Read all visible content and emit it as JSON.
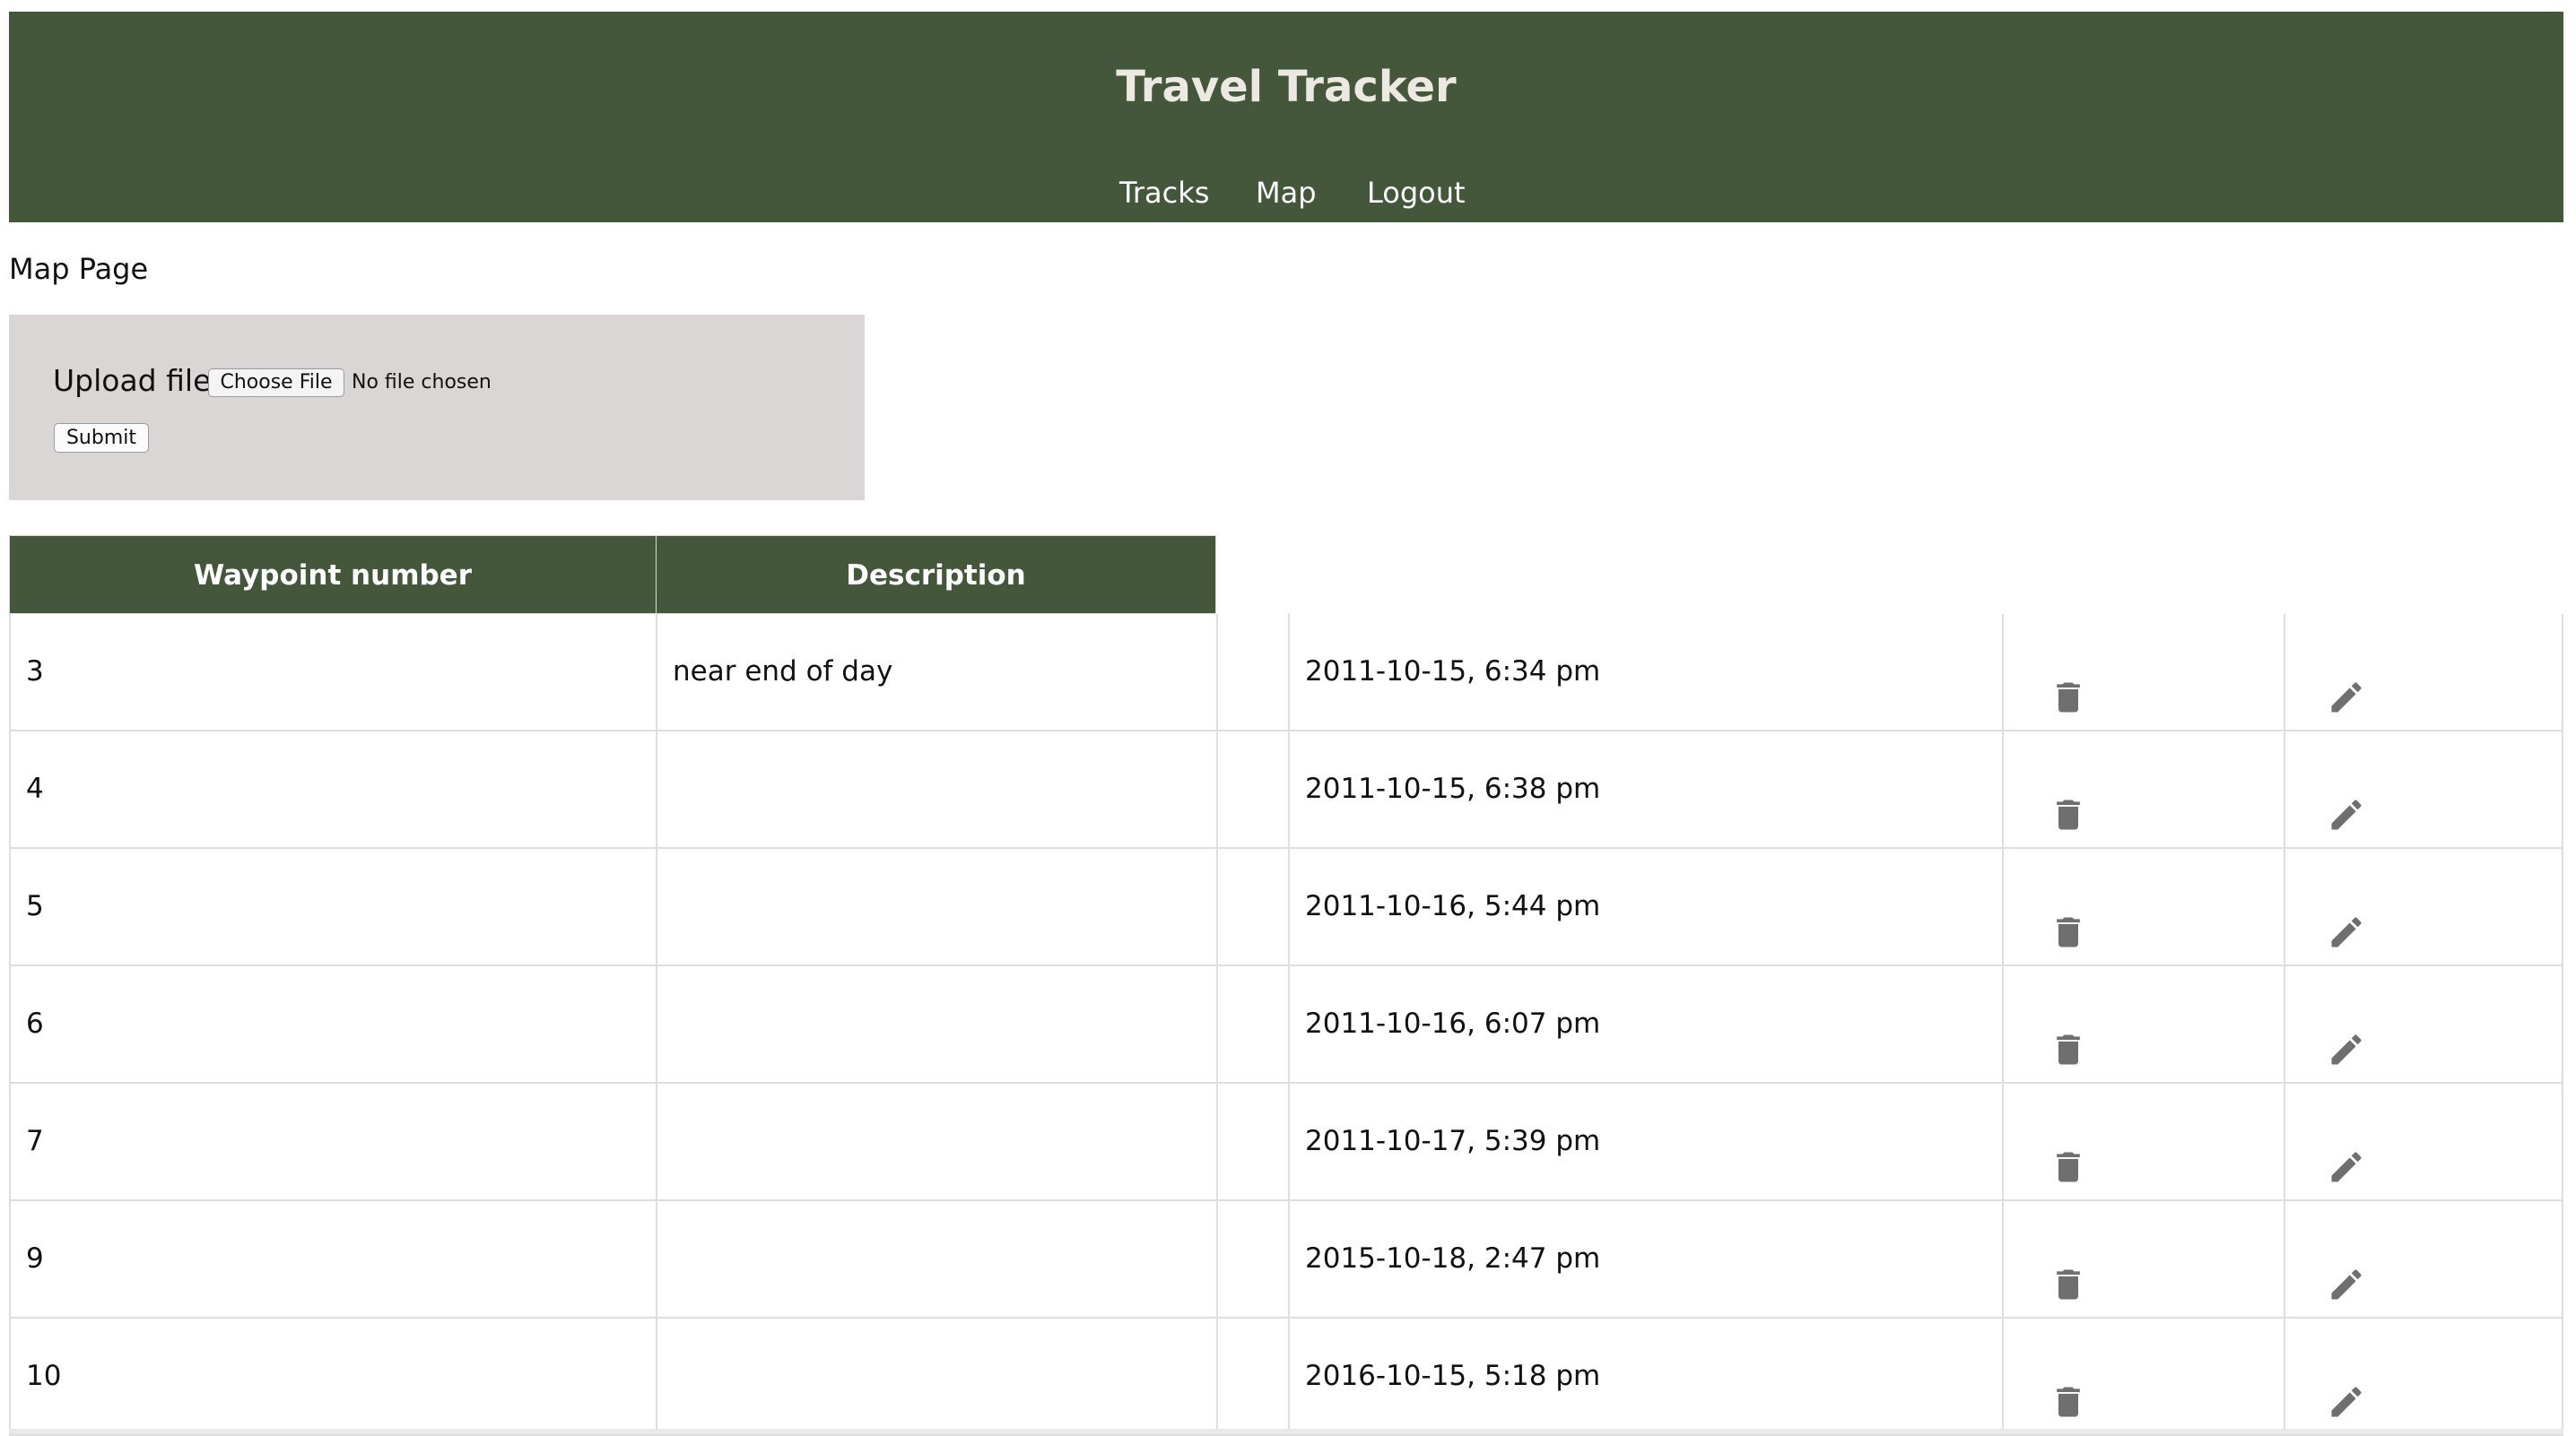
{
  "header": {
    "title": "Travel Tracker",
    "nav": [
      "Tracks",
      "Map",
      "Logout"
    ],
    "background_color": "#44573a"
  },
  "page": {
    "label": "Map Page"
  },
  "upload": {
    "label": "Upload file:",
    "choose_button": "Choose File",
    "file_status": "No file chosen",
    "submit_button": "Submit"
  },
  "table": {
    "headers": [
      "Waypoint number",
      "Description"
    ],
    "rows": [
      {
        "number": "3",
        "description": "near end of day",
        "time": "2011-10-15, 6:34 pm"
      },
      {
        "number": "4",
        "description": "",
        "time": "2011-10-15, 6:38 pm"
      },
      {
        "number": "5",
        "description": "",
        "time": "2011-10-16, 5:44 pm"
      },
      {
        "number": "6",
        "description": "",
        "time": "2011-10-16, 6:07 pm"
      },
      {
        "number": "7",
        "description": "",
        "time": "2011-10-17, 5:39 pm"
      },
      {
        "number": "9",
        "description": "",
        "time": "2015-10-18, 2:47 pm"
      },
      {
        "number": "10",
        "description": "",
        "time": "2016-10-15, 5:18 pm"
      }
    ],
    "row_icons": [
      "trash-icon",
      "pencil-icon"
    ]
  }
}
